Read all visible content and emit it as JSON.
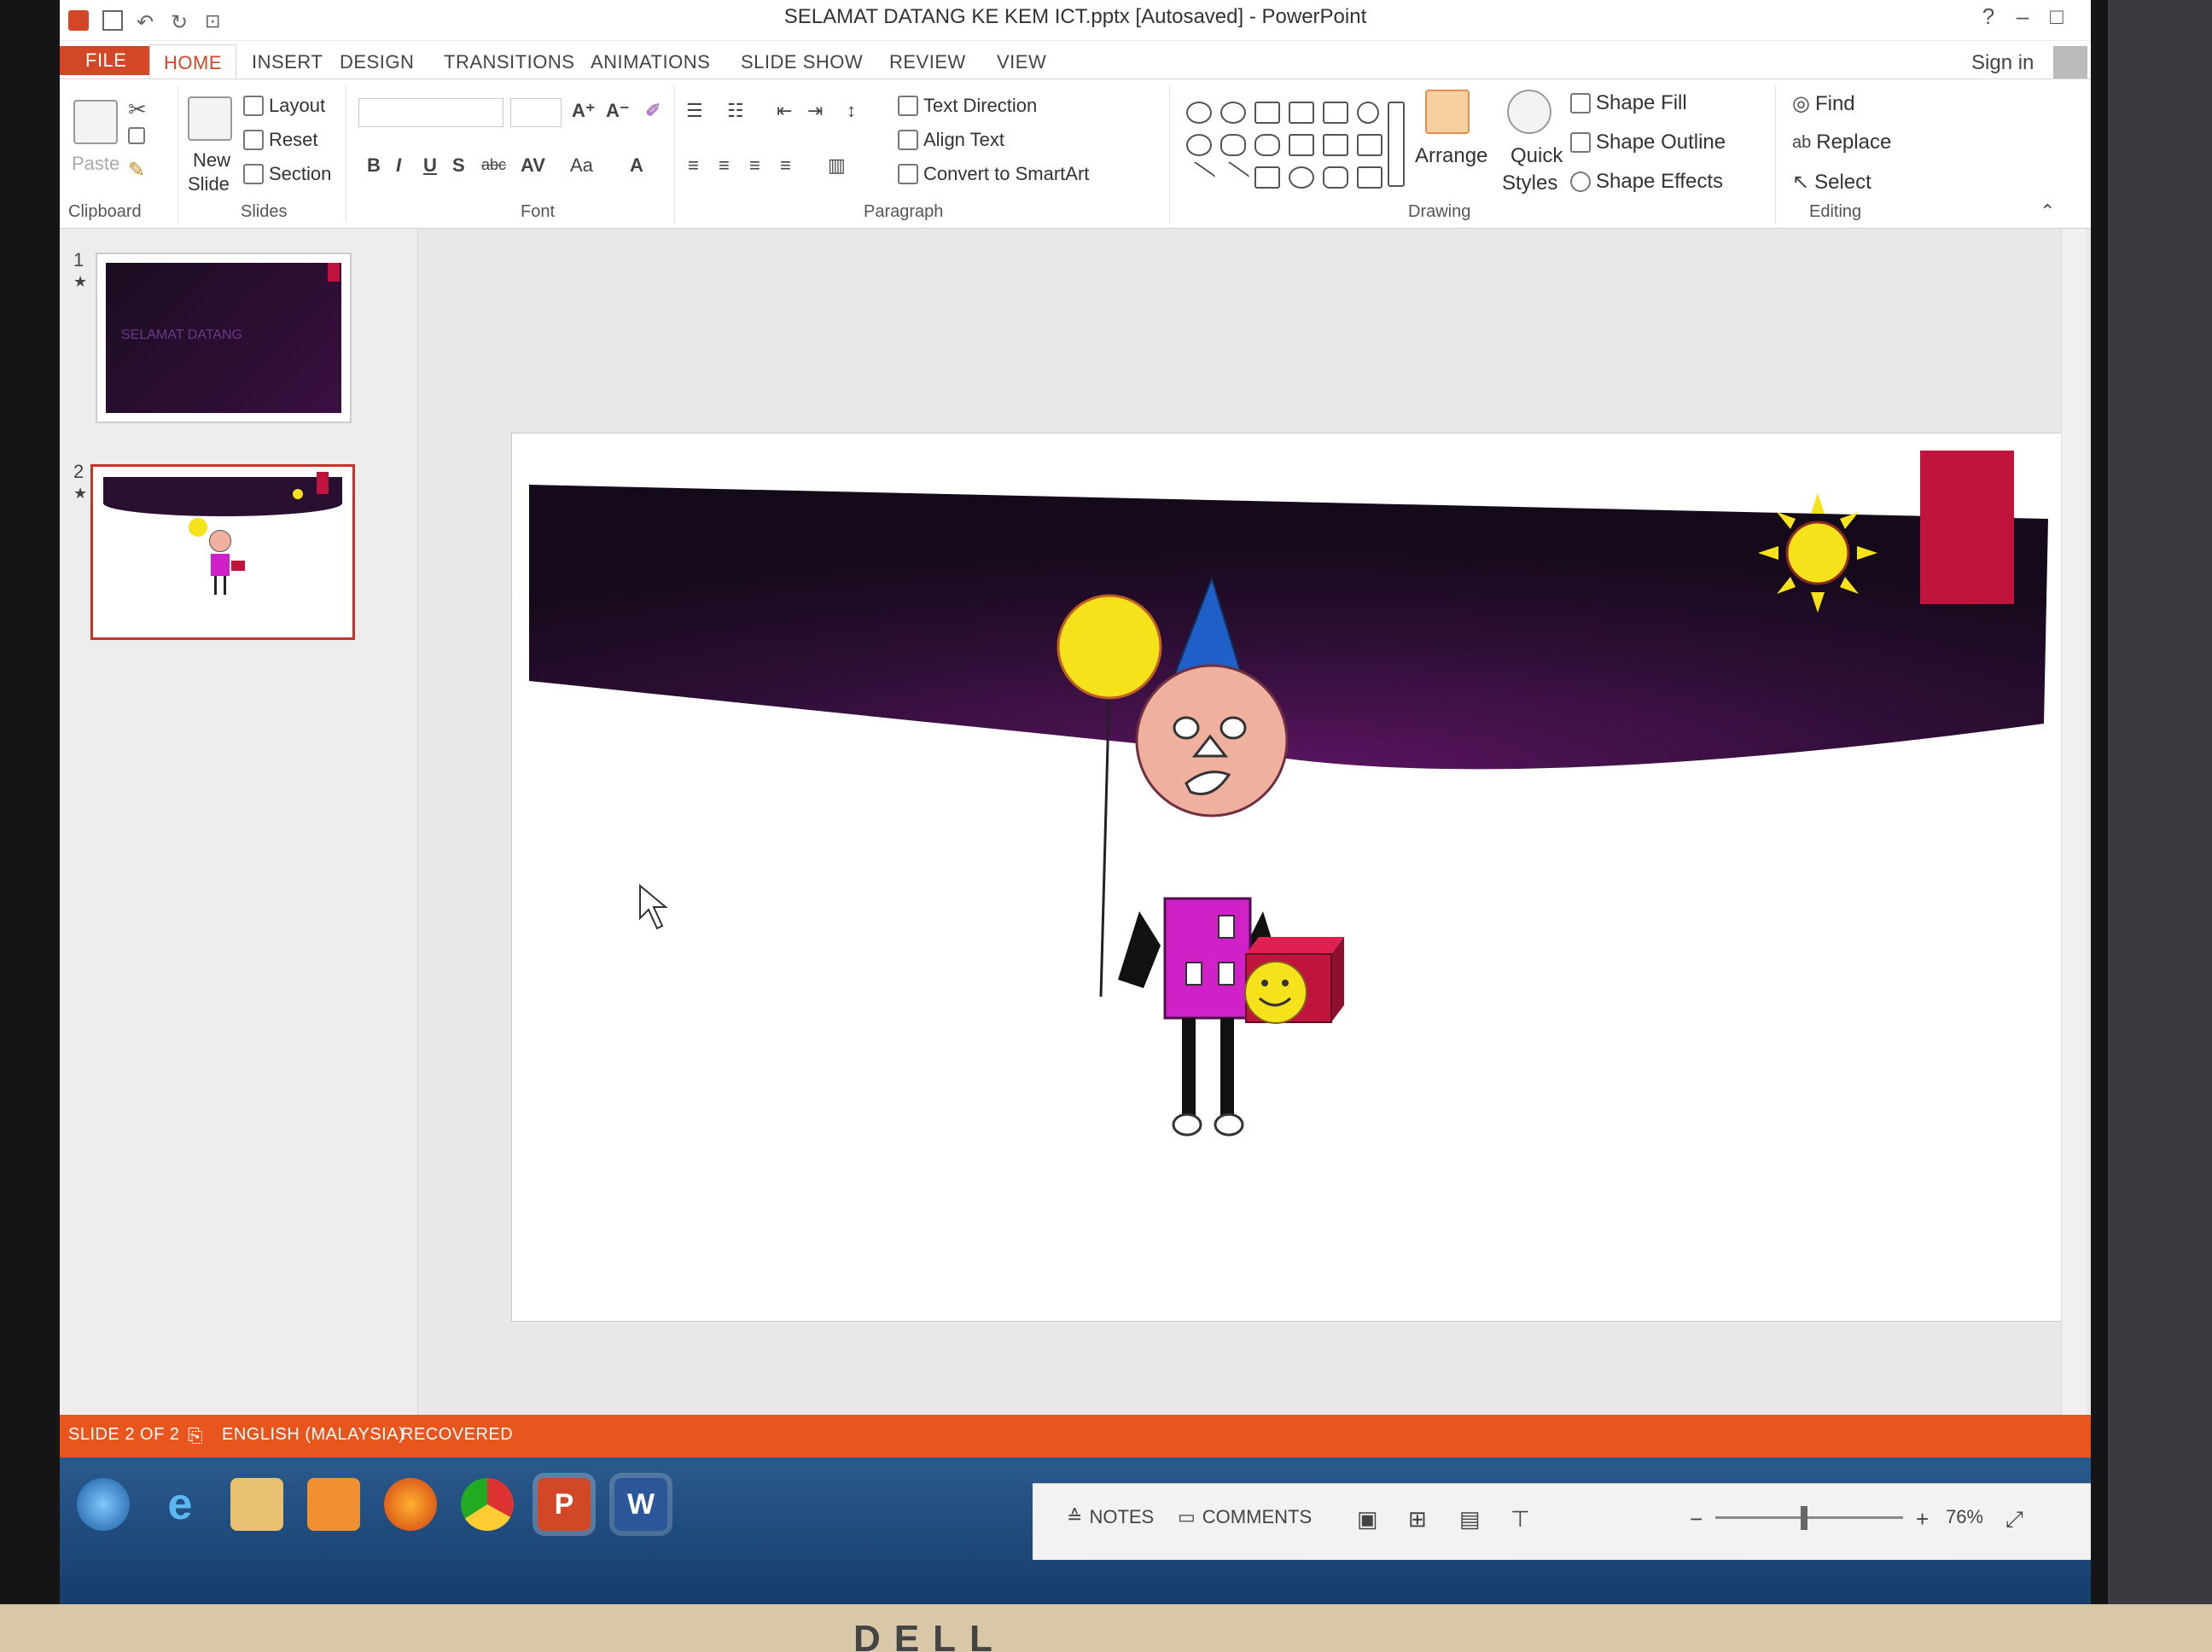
{
  "app": {
    "title": "SELAMAT DATANG KE KEM ICT.pptx [Autosaved] - PowerPoint",
    "sign_in": "Sign in"
  },
  "menu": [
    "FILE",
    "HOME",
    "INSERT",
    "DESIGN",
    "TRANSITIONS",
    "ANIMATIONS",
    "SLIDE SHOW",
    "REVIEW",
    "VIEW"
  ],
  "ribbon": {
    "clipboard": {
      "paste": "Paste",
      "label": "Clipboard"
    },
    "slides": {
      "new_slide_1": "New",
      "new_slide_2": "Slide",
      "layout": "Layout",
      "reset": "Reset",
      "section": "Section",
      "label": "Slides"
    },
    "font": {
      "label": "Font",
      "bold": "B",
      "italic": "I",
      "underline": "U",
      "shadow": "S",
      "strike": "abc",
      "spacing": "AV",
      "case": "Aa",
      "color": "A"
    },
    "paragraph": {
      "label": "Paragraph",
      "text_direction": "Text Direction",
      "align_text": "Align Text",
      "smartart": "Convert to SmartArt"
    },
    "drawing": {
      "label": "Drawing",
      "arrange": "Arrange",
      "quick_1": "Quick",
      "quick_2": "Styles",
      "fill": "Shape Fill",
      "outline": "Shape Outline",
      "effects": "Shape Effects"
    },
    "editing": {
      "label": "Editing",
      "find": "Find",
      "replace": "Replace",
      "select": "Select"
    }
  },
  "thumbnails": [
    {
      "num": "1",
      "caption": "SELAMAT DATANG"
    },
    {
      "num": "2",
      "caption": ""
    }
  ],
  "status": {
    "slide": "SLIDE 2 OF 2",
    "language": "ENGLISH (MALAYSIA)",
    "recovered": "RECOVERED",
    "notes": "NOTES",
    "comments": "COMMENTS",
    "zoom": "76%"
  },
  "monitor_brand": "DELL",
  "colors": {
    "accent": "#d24726",
    "banner": "#2a1030",
    "sun": "#f5e21a",
    "red_rect": "#c0143c",
    "hat": "#1f5fc8",
    "face": "#f0b0a0",
    "body": "#d020c8"
  },
  "taskbar_icons": [
    "start-orb-icon",
    "internet-explorer-icon",
    "file-explorer-icon",
    "media-player-icon",
    "firefox-icon",
    "chrome-icon",
    "powerpoint-icon",
    "word-icon"
  ]
}
